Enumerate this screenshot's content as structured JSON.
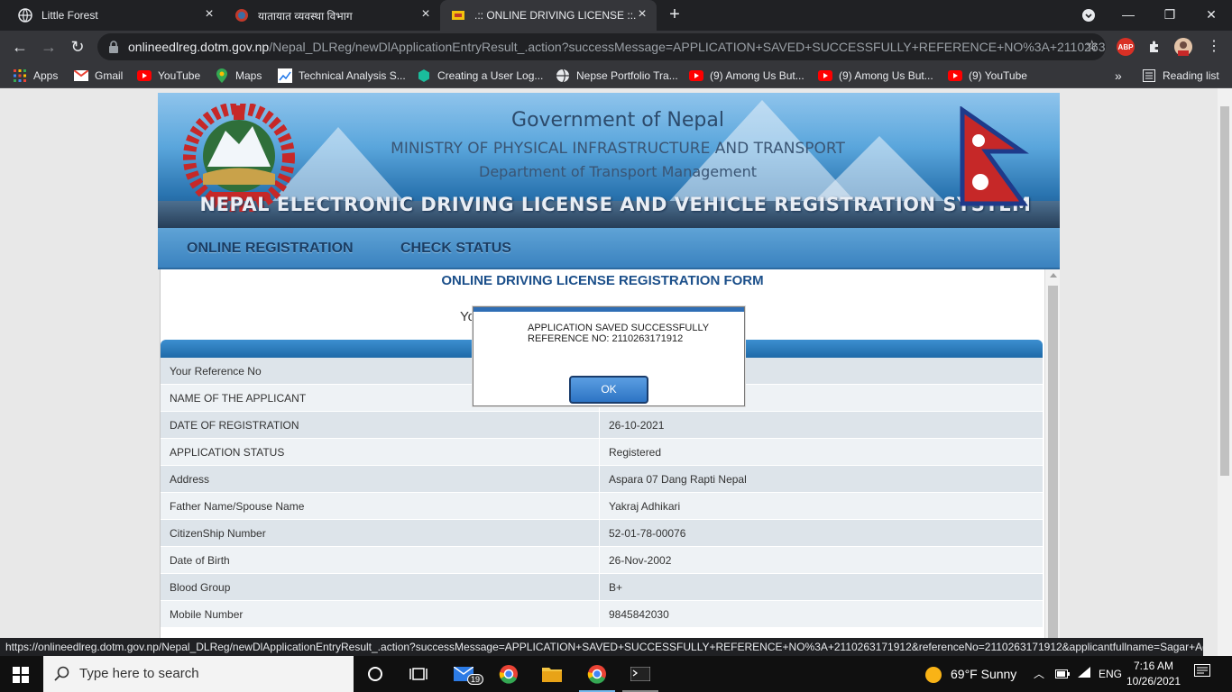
{
  "browser": {
    "tabs": [
      {
        "title": "Little Forest",
        "active": false
      },
      {
        "title": "यातायात व्यवस्था विभाग",
        "active": false
      },
      {
        "title": ".:: ONLINE DRIVING LICENSE ::.",
        "active": true
      }
    ],
    "url_host": "onlineedlreg.dotm.gov.np",
    "url_path": "/Nepal_DLReg/newDlApplicationEntryResult_.action?successMessage=APPLICATION+SAVED+SUCCESSFULLY+REFERENCE+NO%3A+2110263...",
    "bookmarks": [
      "Apps",
      "Gmail",
      "YouTube",
      "Maps",
      "Technical Analysis S...",
      "Creating a User Log...",
      "Nepse Portfolio Tra...",
      "(9) Among Us But...",
      "(9) Among Us But...",
      "(9) YouTube"
    ],
    "overflow": "»",
    "reading_list": "Reading list",
    "abp_label": "ABP"
  },
  "banner": {
    "line1": "Government of Nepal",
    "line2": "MINISTRY OF PHYSICAL INFRASTRUCTURE AND TRANSPORT",
    "line3": "Department of Transport Management",
    "line4": "NEPAL ELECTRONIC DRIVING LICENSE AND VEHICLE REGISTRATION SYSTEM"
  },
  "menu": [
    "ONLINE REGISTRATION",
    "CHECK STATUS"
  ],
  "form": {
    "title": "ONLINE DRIVING LICENSE REGISTRATION FORM",
    "partial_text": "Yo",
    "rows": [
      {
        "label": "Your Reference No",
        "value": ""
      },
      {
        "label": "NAME OF THE APPLICANT",
        "value": ""
      },
      {
        "label": "DATE OF REGISTRATION",
        "value": "26-10-2021"
      },
      {
        "label": "APPLICATION STATUS",
        "value": "Registered"
      },
      {
        "label": "Address",
        "value": "Aspara 07 Dang Rapti Nepal"
      },
      {
        "label": "Father Name/Spouse Name",
        "value": "Yakraj Adhikari"
      },
      {
        "label": "CitizenShip Number",
        "value": "52-01-78-00076"
      },
      {
        "label": "Date of Birth",
        "value": "26-Nov-2002"
      },
      {
        "label": "Blood Group",
        "value": "B+"
      },
      {
        "label": "Mobile Number",
        "value": "9845842030"
      }
    ]
  },
  "dialog": {
    "line1": "APPLICATION SAVED SUCCESSFULLY",
    "line2": "REFERENCE NO: 2110263171912",
    "ok": "OK"
  },
  "status_url": "https://onlineedlreg.dotm.gov.np/Nepal_DLReg/newDlApplicationEntryResult_.action?successMessage=APPLICATION+SAVED+SUCCESSFULLY+REFERENCE+NO%3A+2110263171912&referenceNo=2110263171912&applicantfullname=Sagar+Adhik...",
  "taskbar": {
    "search_placeholder": "Type here to search",
    "mail_badge": "19",
    "weather": "69°F  Sunny",
    "lang": "ENG",
    "time": "7:16 AM",
    "date": "10/26/2021"
  },
  "colors": {
    "accent": "#2f6eb5",
    "row_odd": "#dde4ea",
    "row_even": "#eef2f5",
    "chrome_dark": "#202124"
  }
}
